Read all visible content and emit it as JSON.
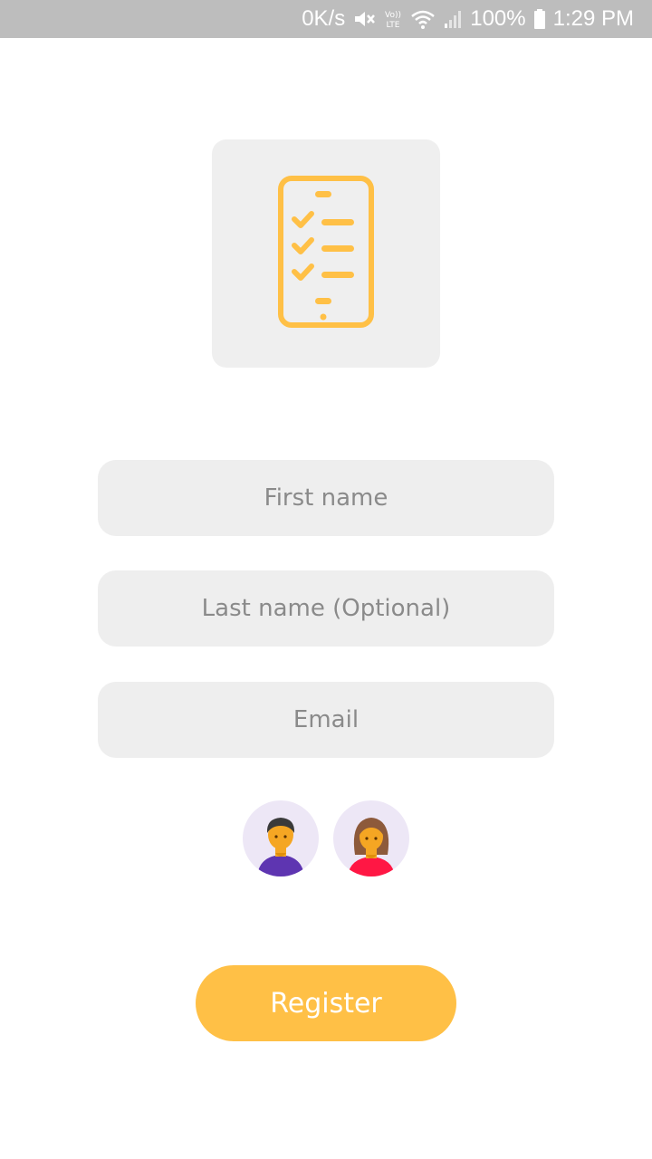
{
  "status_bar": {
    "network_speed": "0K/s",
    "volte_label": "Vo)) LTE",
    "battery": "100%",
    "time": "1:29 PM"
  },
  "logo": {
    "icon": "checklist-phone-icon",
    "accent_color": "#ffc046",
    "background_color": "#efefef"
  },
  "form": {
    "first_name_placeholder": "First name",
    "first_name_value": "",
    "last_name_placeholder": "Last name (Optional)",
    "last_name_value": "",
    "email_placeholder": "Email",
    "email_value": ""
  },
  "avatars": [
    {
      "icon": "male-avatar-icon"
    },
    {
      "icon": "female-avatar-icon"
    }
  ],
  "register": {
    "label": "Register",
    "color": "#ffc046"
  }
}
